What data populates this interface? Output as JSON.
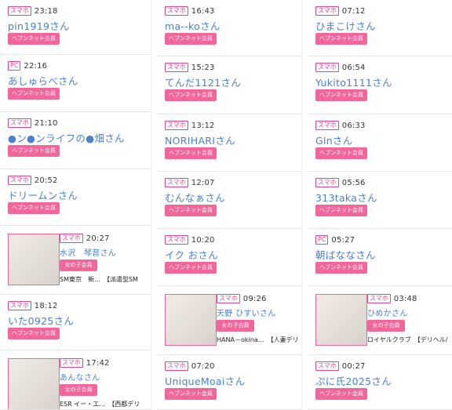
{
  "columns": [
    [
      {
        "type": "member",
        "tag": "スマホ",
        "time": "23:18",
        "name": "pin1919さん",
        "badge": "ヘブンネット会員"
      },
      {
        "type": "member",
        "tag": "PC",
        "time": "22:16",
        "name": "あしゅらべさん",
        "badge": "ヘブンネット会員"
      },
      {
        "type": "member",
        "tag": "スマホ",
        "time": "21:10",
        "name": "●ン●ンライフの●畑さん",
        "badge": "ヘブンネット会員"
      },
      {
        "type": "member",
        "tag": "スマホ",
        "time": "20:52",
        "name": "ドリームンさん",
        "badge": "ヘブンネット会員"
      },
      {
        "type": "girl",
        "tag": "スマホ",
        "time": "20:27",
        "name": "水沢　琴音さん",
        "badge": "女の子会員",
        "store": "SM東京　新…　【派遣型SM"
      },
      {
        "type": "member",
        "tag": "スマホ",
        "time": "18:12",
        "name": "いた0925さん",
        "badge": "ヘブンネット会員"
      },
      {
        "type": "girl",
        "tag": "スマホ",
        "time": "17:42",
        "name": "あんなさん",
        "badge": "女の子会員",
        "store": "ESR イー・エ…　【西都デリ"
      }
    ],
    [
      {
        "type": "member",
        "tag": "スマホ",
        "time": "16:43",
        "name": "ma--koさん",
        "badge": "ヘブンネット会員"
      },
      {
        "type": "member",
        "tag": "スマホ",
        "time": "15:23",
        "name": "てんだ1121さん",
        "badge": "ヘブンネット会員"
      },
      {
        "type": "member",
        "tag": "スマホ",
        "time": "13:12",
        "name": "NORIHARIさん",
        "badge": "ヘブンネット会員"
      },
      {
        "type": "member",
        "tag": "スマホ",
        "time": "12:07",
        "name": "むんなぁさん",
        "badge": "ヘブンネット会員"
      },
      {
        "type": "member",
        "tag": "スマホ",
        "time": "10:20",
        "name": "イク おさん",
        "badge": "ヘブンネット会員"
      },
      {
        "type": "girl",
        "tag": "スマホ",
        "time": "09:26",
        "name": "天野 ひすいさん",
        "badge": "女の子会員",
        "store": "HANA－okina…　【人妻デリ"
      },
      {
        "type": "member",
        "tag": "スマホ",
        "time": "07:20",
        "name": "UniqueMoaiさん",
        "badge": "ヘブンネット会員"
      }
    ],
    [
      {
        "type": "member",
        "tag": "スマホ",
        "time": "07:12",
        "name": "ひまこけさん",
        "badge": "ヘブンネット会員"
      },
      {
        "type": "member",
        "tag": "スマホ",
        "time": "06:54",
        "name": "Yukito1111さん",
        "badge": "ヘブンネット会員"
      },
      {
        "type": "member",
        "tag": "スマホ",
        "time": "06:33",
        "name": "Glnさん",
        "badge": "ヘブンネット会員"
      },
      {
        "type": "member",
        "tag": "スマホ",
        "time": "05:56",
        "name": "313takaさん",
        "badge": "ヘブンネット会員"
      },
      {
        "type": "member",
        "tag": "PC",
        "time": "05:27",
        "name": "朝ばななさん",
        "badge": "ヘブンネット会員"
      },
      {
        "type": "girl",
        "tag": "スマホ",
        "time": "03:48",
        "name": "ひめかさん",
        "badge": "女の子会員",
        "store": "ロイヤルクラブ　【デリヘル/"
      },
      {
        "type": "member",
        "tag": "スマホ",
        "time": "00:27",
        "name": "ぷに氏2025さん",
        "badge": "ヘブンネット会員"
      }
    ]
  ]
}
